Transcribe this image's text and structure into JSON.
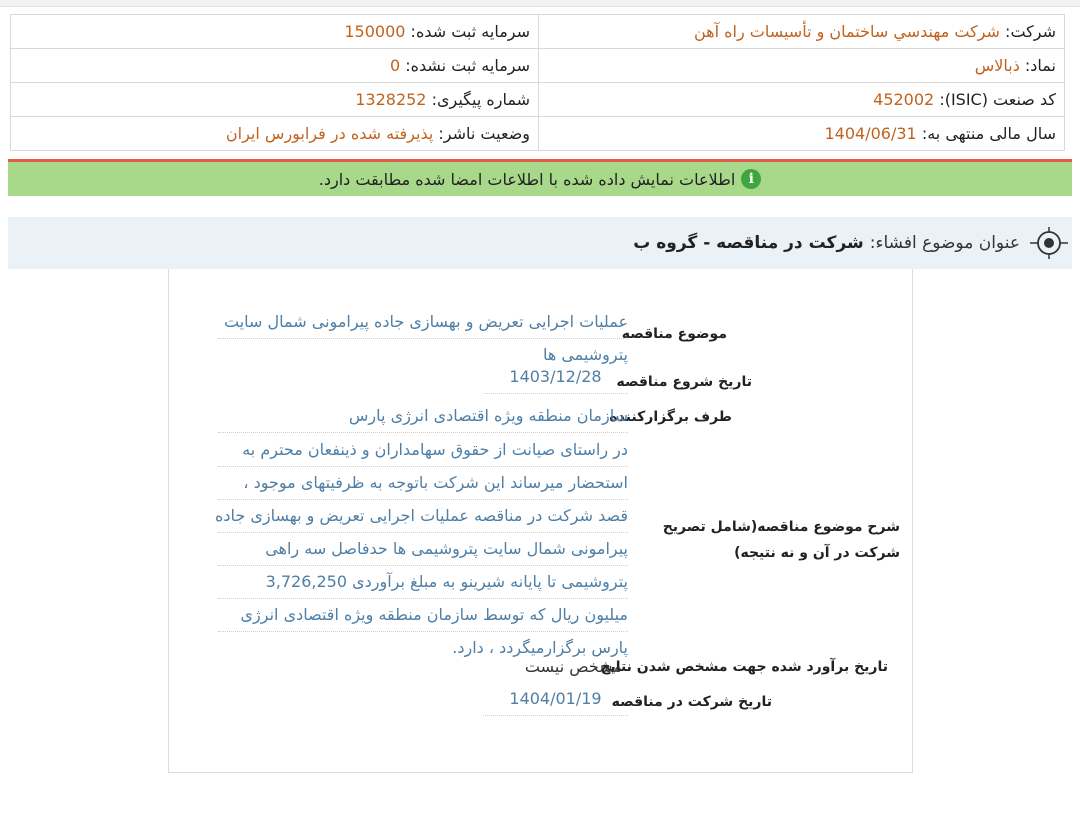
{
  "company_info": {
    "company_label": "شرکت:",
    "company_value": "شرکت مهندسي ساختمان و تأسيسات راه آهن",
    "registered_capital_label": "سرمایه ثبت شده:",
    "registered_capital_value": "150000",
    "symbol_label": "نماد:",
    "symbol_value": "ذبالاس",
    "unregistered_capital_label": "سرمایه ثبت نشده:",
    "unregistered_capital_value": "0",
    "isic_label": "کد صنعت (ISIC):",
    "isic_value": "452002",
    "tracking_label": "شماره پیگیری:",
    "tracking_value": "1328252",
    "fiscal_year_label": "سال مالی منتهی به:",
    "fiscal_year_value": "1404/06/31",
    "publisher_status_label": "وضعیت ناشر:",
    "publisher_status_value": "پذیرفته شده در فرابورس ایران"
  },
  "notice": {
    "text": "اطلاعات نمایش داده شده با اطلاعات امضا شده مطابقت دارد.",
    "icon": "info-icon",
    "color": "#a8d88a"
  },
  "disclosure": {
    "label": "عنوان موضوع افشاء:",
    "title": "شرکت در مناقصه - گروه ب"
  },
  "tender": {
    "subject_label": "موضوع مناقصه",
    "subject_line1": "عملیات اجرایی تعریض و بهسازی جاده پیرامونی شمال سایت",
    "subject_line2": "پتروشیمی ها",
    "start_date_label": "تاریخ شروع مناقصه",
    "start_date_value": "1403/12/28",
    "organizer_label": "طرف برگزارکننده",
    "organizer_value": "سازمان منطقه ویژه اقتصادی انرژی پارس",
    "description_label": "شرح موضوع مناقصه(شامل تصریح شرکت در آن و نه نتیجه)",
    "description_lines": [
      "در راستای صیانت از حقوق سهامداران و ذینفعان محترم به",
      "استحضار میرساند این شرکت باتوجه به ظرفیتهای موجود ،",
      "قصد شرکت در مناقصه عملیات اجرایی تعریض و بهسازی جاده",
      "پیرامونی شمال سایت پتروشیمی ها حدفاصل سه راهی",
      "پتروشیمی تا پایانه شیرینو به مبلغ برآوردی 3,726,250",
      "میلیون ریال که توسط سازمان منطقه ویژه اقتصادی انرژی",
      "پارس برگزارمیگردد ، دارد."
    ],
    "estimated_result_date_label": "تاریخ برآورد شده جهت مشخص شدن نتایج",
    "estimated_result_date_value": "مشخص نیست",
    "participation_date_label": "تاریخ شرکت در مناقصه",
    "participation_date_value": "1404/01/19"
  }
}
